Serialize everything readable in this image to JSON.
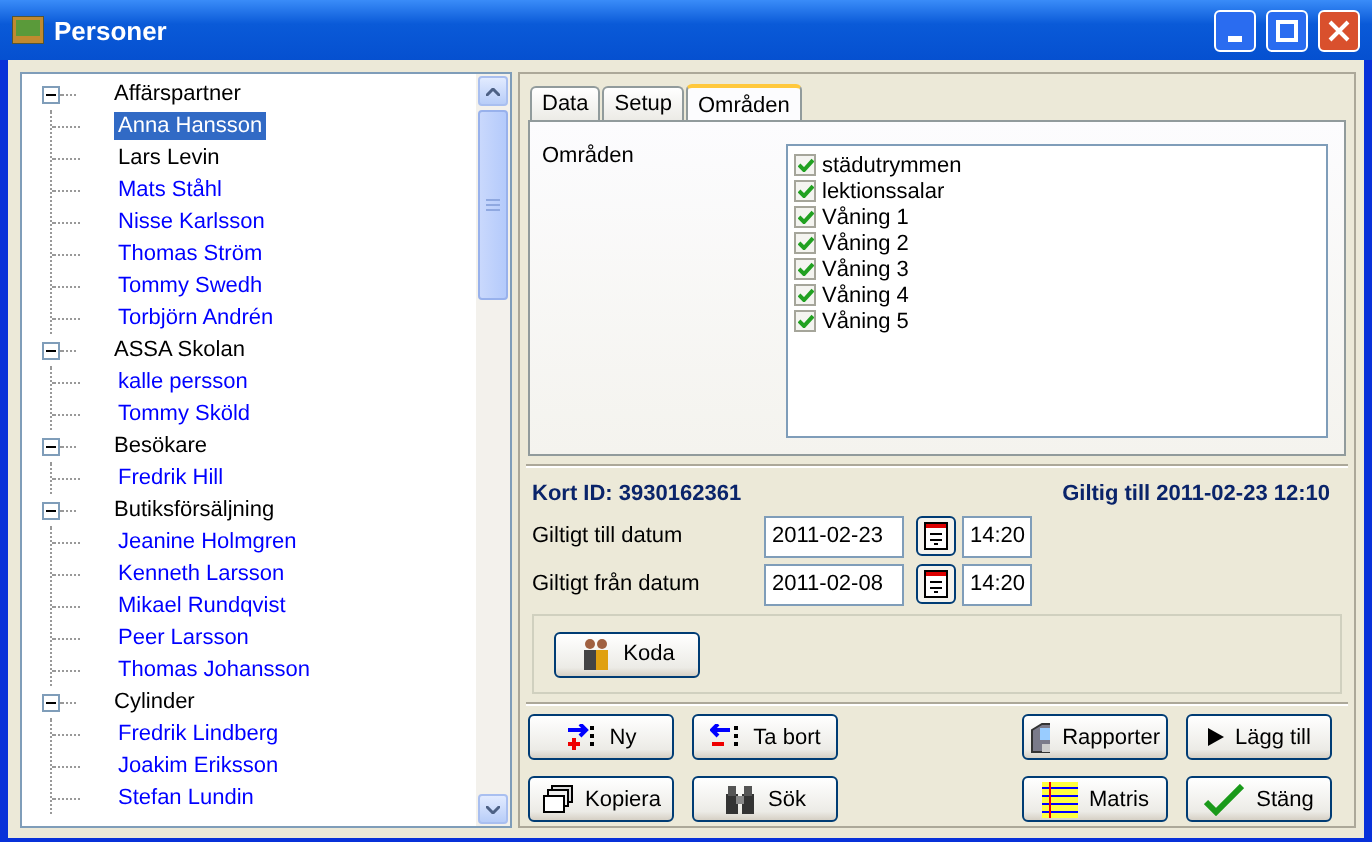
{
  "window": {
    "title": "Personer"
  },
  "tree": [
    {
      "label": "Affärspartner",
      "expanded": true,
      "children": [
        {
          "label": "Anna Hansson",
          "selected": true
        },
        {
          "label": "Lars Levin",
          "selected": false,
          "color": "#000000"
        },
        {
          "label": "Mats Ståhl",
          "selected": false,
          "color": "#0000ff"
        },
        {
          "label": "Nisse Karlsson",
          "selected": false,
          "color": "#0000ff"
        },
        {
          "label": "Thomas Ström",
          "selected": false,
          "color": "#0000ff"
        },
        {
          "label": "Tommy Swedh",
          "selected": false,
          "color": "#0000ff"
        },
        {
          "label": "Torbjörn Andrén",
          "selected": false,
          "color": "#0000ff"
        }
      ]
    },
    {
      "label": "ASSA Skolan",
      "expanded": true,
      "children": [
        {
          "label": "kalle persson",
          "selected": false,
          "color": "#0000ff"
        },
        {
          "label": "Tommy Sköld",
          "selected": false,
          "color": "#0000ff"
        }
      ]
    },
    {
      "label": "Besökare",
      "expanded": true,
      "children": [
        {
          "label": "Fredrik Hill",
          "selected": false,
          "color": "#0000ff"
        }
      ]
    },
    {
      "label": "Butiksförsäljning",
      "expanded": true,
      "children": [
        {
          "label": "Jeanine Holmgren",
          "selected": false,
          "color": "#0000ff"
        },
        {
          "label": "Kenneth Larsson",
          "selected": false,
          "color": "#0000ff"
        },
        {
          "label": "Mikael Rundqvist",
          "selected": false,
          "color": "#0000ff"
        },
        {
          "label": "Peer Larsson",
          "selected": false,
          "color": "#0000ff"
        },
        {
          "label": "Thomas Johansson",
          "selected": false,
          "color": "#0000ff"
        }
      ]
    },
    {
      "label": "Cylinder",
      "expanded": true,
      "children": [
        {
          "label": "Fredrik Lindberg",
          "selected": false,
          "color": "#0000ff"
        },
        {
          "label": "Joakim Eriksson",
          "selected": false,
          "color": "#0000ff"
        },
        {
          "label": "Stefan Lundin",
          "selected": false,
          "color": "#0000ff"
        }
      ]
    }
  ],
  "tabs": [
    {
      "label": "Data",
      "selected": false
    },
    {
      "label": "Setup",
      "selected": false
    },
    {
      "label": "Områden",
      "selected": true
    }
  ],
  "areas": {
    "label": "Områden",
    "items": [
      {
        "label": "städutrymmen",
        "checked": true
      },
      {
        "label": "lektionssalar",
        "checked": true
      },
      {
        "label": "Våning 1",
        "checked": true
      },
      {
        "label": "Våning 2",
        "checked": true
      },
      {
        "label": "Våning 3",
        "checked": true
      },
      {
        "label": "Våning 4",
        "checked": true
      },
      {
        "label": "Våning 5",
        "checked": true
      }
    ]
  },
  "card": {
    "id": "Kort ID: 3930162361",
    "valid": "Giltig till 2011-02-23 12:10"
  },
  "dates": [
    {
      "label": "Giltigt till datum",
      "date": "2011-02-23",
      "time": "14:20"
    },
    {
      "label": "Giltigt från datum",
      "date": "2011-02-08",
      "time": "14:20"
    }
  ],
  "code_button": "Koda",
  "buttons": [
    {
      "label": "Ny",
      "kind": "new"
    },
    {
      "label": "Ta bort",
      "kind": "remove"
    },
    {
      "label": "Rapporter",
      "kind": "reports"
    },
    {
      "label": "Lägg till",
      "kind": "add"
    },
    {
      "label": "Kopiera",
      "kind": "copy"
    },
    {
      "label": "Sök",
      "kind": "search"
    },
    {
      "label": "Matris",
      "kind": "matrix"
    },
    {
      "label": "Stäng",
      "kind": "close"
    }
  ]
}
